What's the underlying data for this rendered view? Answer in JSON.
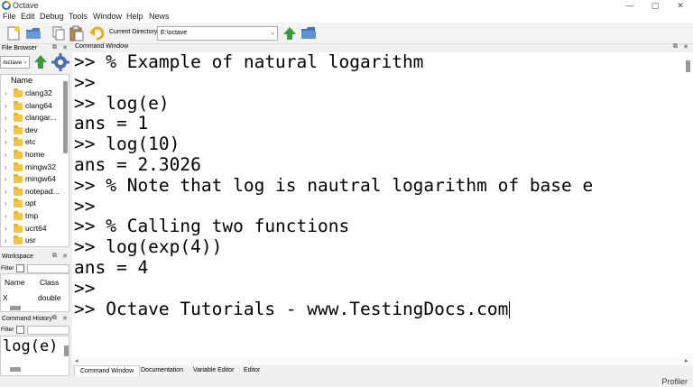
{
  "window": {
    "title": "Octave",
    "minimize": "—",
    "maximize": "▢",
    "close": "✕"
  },
  "menu": [
    "File",
    "Edit",
    "Debug",
    "Tools",
    "Window",
    "Help",
    "News"
  ],
  "toolbar": {
    "current_directory_label": "Current Directory:",
    "current_directory_value": "E:\\octave"
  },
  "file_browser": {
    "title": "File Browser",
    "path": "/octave",
    "column_header": "Name",
    "items": [
      "clang32",
      "clang64",
      "clangar...",
      "dev",
      "etc",
      "home",
      "mingw32",
      "mingw64",
      "notepad...",
      "opt",
      "tmp",
      "ucrt64",
      "usr"
    ]
  },
  "workspace": {
    "title": "Workspace",
    "filter_label": "Filter",
    "columns": [
      "Name",
      "Class"
    ],
    "rows": [
      {
        "name": "X",
        "class": "double"
      }
    ]
  },
  "command_history": {
    "title": "Command History",
    "filter_label": "Filter",
    "entries": [
      "log(e)"
    ]
  },
  "command_window": {
    "title": "Command Window",
    "lines": [
      ">> % Example of natural logarithm",
      ">>",
      ">> log(e)",
      "ans = 1",
      ">> log(10)",
      "ans = 2.3026",
      ">> % Note that log is nautral logarithm of base e",
      ">>",
      ">> % Calling two functions",
      ">> log(exp(4))",
      "ans = 4",
      ">>",
      ">> Octave Tutorials - www.TestingDocs.com"
    ]
  },
  "tabs": [
    "Command Window",
    "Documentation",
    "Variable Editor",
    "Editor"
  ],
  "status": {
    "profiler": "Profiler"
  },
  "colors": {
    "accent_green": "#3a9a3a",
    "folder_yellow": "#f4c542",
    "logo_blue": "#1f6fb5",
    "logo_orange": "#f28a1c"
  }
}
